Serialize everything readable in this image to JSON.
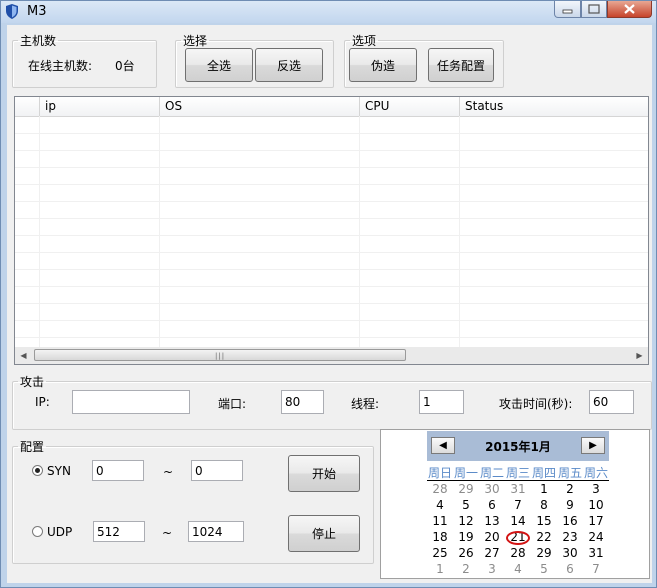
{
  "window": {
    "title": "M3"
  },
  "hosts_group": {
    "legend": "主机数",
    "online_label": "在线主机数:",
    "online_value": "0台"
  },
  "select_group": {
    "legend": "选择",
    "select_all": "全选",
    "invert": "反选"
  },
  "options_group": {
    "legend": "选项",
    "disguise": "伪造",
    "task_config": "任务配置"
  },
  "table": {
    "columns": [
      "",
      "ip",
      "OS",
      "CPU",
      "Status"
    ]
  },
  "attack_group": {
    "legend": "攻击",
    "ip_label": "IP:",
    "ip_value": "",
    "port_label": "端口:",
    "port_value": "80",
    "threads_label": "线程:",
    "threads_value": "1",
    "time_label": "攻击时间(秒):",
    "time_value": "60"
  },
  "config_group": {
    "legend": "配置",
    "syn_label": "SYN",
    "syn_checked": true,
    "syn_from": "0",
    "syn_to": "0",
    "udp_label": "UDP",
    "udp_checked": false,
    "udp_from": "512",
    "udp_to": "1024",
    "tilde": "~",
    "start_button": "开始",
    "stop_button": "停止"
  },
  "calendar": {
    "title": "2015年1月",
    "prev_icon": "chevron-left-icon",
    "next_icon": "chevron-right-icon",
    "weekdays": [
      "周日",
      "周一",
      "周二",
      "周三",
      "周四",
      "周五",
      "周六"
    ],
    "weeks": [
      [
        "28",
        "29",
        "30",
        "31",
        "1",
        "2",
        "3"
      ],
      [
        "4",
        "5",
        "6",
        "7",
        "8",
        "9",
        "10"
      ],
      [
        "11",
        "12",
        "13",
        "14",
        "15",
        "16",
        "17"
      ],
      [
        "18",
        "19",
        "20",
        "21",
        "22",
        "23",
        "24"
      ],
      [
        "25",
        "26",
        "27",
        "28",
        "29",
        "30",
        "31"
      ],
      [
        "1",
        "2",
        "3",
        "4",
        "5",
        "6",
        "7"
      ]
    ],
    "today": "21",
    "colors": {
      "header_bg": "#a9bcd6",
      "weekday": "#5a8ac8",
      "today_ring": "#d21414",
      "other_month": "#8c8c8c"
    }
  }
}
